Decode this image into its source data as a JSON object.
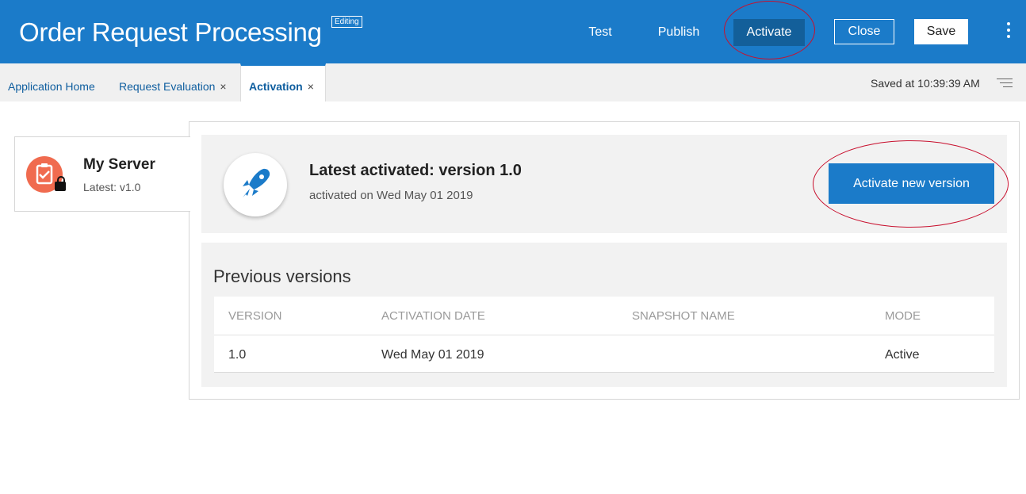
{
  "header": {
    "title": "Order Request Processing",
    "badge": "Editing",
    "buttons": {
      "test": "Test",
      "publish": "Publish",
      "activate": "Activate",
      "close": "Close",
      "save": "Save"
    }
  },
  "tabs": [
    {
      "label": "Application Home"
    },
    {
      "label": "Request Evaluation",
      "close": "×"
    },
    {
      "label": "Activation",
      "close": "×"
    }
  ],
  "status": {
    "saved": "Saved at 10:39:39 AM"
  },
  "server": {
    "name": "My Server",
    "latest": "Latest: v1.0"
  },
  "latest_activation": {
    "title_prefix": "Latest activated: version ",
    "version": "1.0",
    "subtitle": "activated on Wed May 01 2019",
    "button": "Activate new version"
  },
  "previous_versions": {
    "title": "Previous versions",
    "columns": [
      "VERSION",
      "ACTIVATION DATE",
      "SNAPSHOT NAME",
      "MODE"
    ],
    "rows": [
      {
        "version": "1.0",
        "activation_date": "Wed May 01 2019",
        "snapshot_name": "",
        "mode": "Active"
      }
    ]
  },
  "colors": {
    "header": "#1b7bc9",
    "accent": "#1b7bc9",
    "server_icon": "#f06b4f",
    "annotation_ring": "#c8102e"
  },
  "icons": [
    "kebab-menu-icon",
    "list-menu-icon",
    "clipboard-check-icon",
    "lock-icon",
    "rocket-icon"
  ]
}
